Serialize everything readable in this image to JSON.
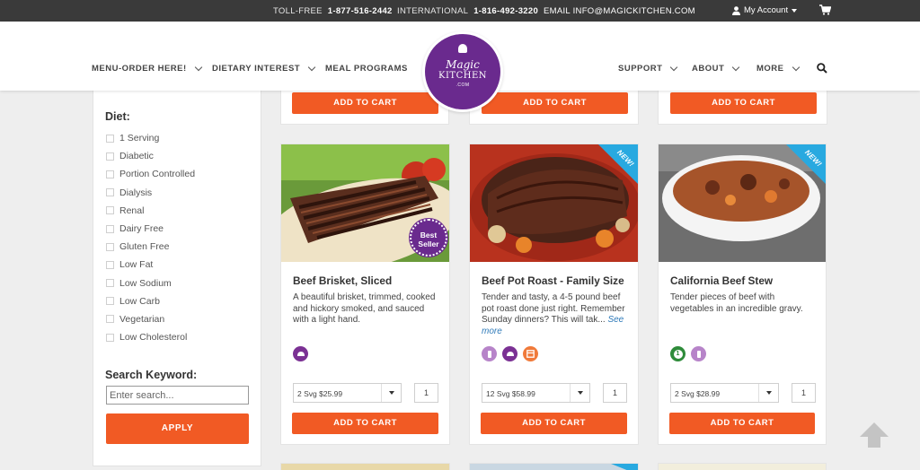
{
  "topbar": {
    "tollfree_label": "TOLL-FREE",
    "tollfree_value": "1-877-516-2442",
    "intl_label": "INTERNATIONAL",
    "intl_value": "1-816-492-3220",
    "email_text": "EMAIL INFO@MAGICKITCHEN.COM",
    "account_label": "My Account"
  },
  "nav": {
    "menu_order": "MENU-ORDER HERE!",
    "dietary": "DIETARY INTEREST",
    "meal_programs": "MEAL PROGRAMS",
    "support": "SUPPORT",
    "about": "ABOUT",
    "more": "MORE"
  },
  "logo": {
    "magic": "Magic",
    "kitchen": "KITCHEN",
    "com": ".COM"
  },
  "sidebar": {
    "diet_heading": "Diet:",
    "diet_items": [
      "1 Serving",
      "Diabetic",
      "Portion Controlled",
      "Dialysis",
      "Renal",
      "Dairy Free",
      "Gluten Free",
      "Low Fat",
      "Low Sodium",
      "Low Carb",
      "Vegetarian",
      "Low Cholesterol"
    ],
    "search_heading": "Search Keyword:",
    "search_placeholder": "Enter search...",
    "apply_label": "APPLY"
  },
  "add_to_cart": "ADD TO CART",
  "products": [
    {
      "title": "Beef Brisket, Sliced",
      "description": "A beautiful brisket, trimmed, cooked and hickory smoked, and sauced with a light hand.",
      "see_more": "",
      "badge": "Best Seller",
      "badge_line1": "Best",
      "badge_line2": "Seller",
      "serving": "2 Svg $25.99",
      "qty": "1"
    },
    {
      "title": "Beef Pot Roast - Family Size",
      "description": "Tender and tasty, a 4-5 pound beef pot roast done just right. Remember Sunday dinners? This will tak...",
      "see_more": "See more",
      "badge": "NEW!",
      "serving": "12 Svg $58.99",
      "qty": "1"
    },
    {
      "title": "California Beef Stew",
      "description": "Tender pieces of beef with vegetables in an incredible gravy.",
      "see_more": "",
      "badge": "NEW!",
      "serving": "2 Svg $28.99",
      "qty": "1"
    }
  ],
  "diet_icon_glyph_1": "1",
  "colors": {
    "accent": "#f15a24",
    "brand_purple": "#6a2a8e",
    "new_badge": "#28a9e0",
    "topbar": "#3a3a3a"
  }
}
